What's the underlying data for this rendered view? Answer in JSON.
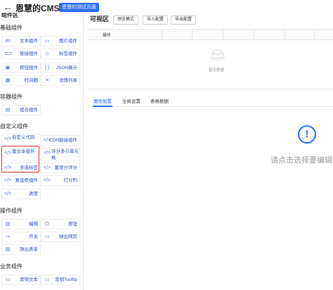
{
  "header": {
    "back_icon": "arrow-left-icon",
    "title": "恩慧的CMS",
    "badge": "恩慧的测试页面"
  },
  "sidebar": {
    "title": "组件区",
    "groups": [
      {
        "title": "基础组件"
      },
      {
        "title": "容器组件"
      },
      {
        "title": "自定义组件"
      },
      {
        "title": "操作组件"
      },
      {
        "title": "业务组件"
      }
    ],
    "items": [
      {
        "label": "文本组件",
        "icon": "text-icon",
        "glyph": "Aᵃ"
      },
      {
        "label": "图片组件",
        "icon": "image-icon",
        "glyph": "▭"
      },
      {
        "label": "链接组件",
        "icon": "link-icon",
        "glyph": "⊂⊃"
      },
      {
        "label": "标签组件",
        "icon": "tag-icon",
        "glyph": "◇"
      },
      {
        "label": "按钮组件",
        "icon": "button-icon",
        "glyph": "▣"
      },
      {
        "label": "JSON展示",
        "icon": "braces-icon",
        "glyph": "{ }"
      },
      {
        "label": "时间戳",
        "icon": "calendar-icon",
        "glyph": "▦"
      },
      {
        "label": "详情列表",
        "icon": "list-icon",
        "glyph": "≡"
      },
      {
        "label": "组合组件",
        "icon": "combine-icon",
        "glyph": "▤"
      },
      {
        "label": "自定义代码",
        "icon": "code-icon",
        "glyph": "</>"
      },
      {
        "label": "CDN链接组件",
        "icon": "code-icon",
        "glyph": "</>"
      },
      {
        "label": "富文本组件",
        "icon": "code-icon",
        "glyph": "</>"
      },
      {
        "label": "评分多行单元格",
        "icon": "code-icon",
        "glyph": "</>"
      },
      {
        "label": "多选标签",
        "icon": "code-icon",
        "glyph": "</>"
      },
      {
        "label": "客观分评分",
        "icon": "code-icon",
        "glyph": "</>"
      },
      {
        "label": "复选框组件",
        "icon": "code-icon",
        "glyph": "</>"
      },
      {
        "label": "打分列",
        "icon": "code-icon",
        "glyph": "</>"
      },
      {
        "label": "进度",
        "icon": "code-icon",
        "glyph": "</>"
      },
      {
        "label": "编辑",
        "icon": "edit-icon",
        "glyph": "▧"
      },
      {
        "label": "按钮",
        "icon": "power-icon",
        "glyph": "⏻"
      },
      {
        "label": "开关",
        "icon": "switch-icon",
        "glyph": "⊸"
      },
      {
        "label": "弹出网页",
        "icon": "window-icon",
        "glyph": "▭"
      },
      {
        "label": "弹出表单",
        "icon": "form-icon",
        "glyph": "▤"
      },
      {
        "label": "营销文本",
        "icon": "file-icon",
        "glyph": "▭"
      },
      {
        "label": "营销Tooltip",
        "icon": "file-icon",
        "glyph": "▭"
      }
    ]
  },
  "canvas": {
    "title": "可视区",
    "buttons": [
      "预览模式",
      "导入配置",
      "导出配置"
    ],
    "table": {
      "operation_header": "操作"
    },
    "empty_icon": "empty-box-icon",
    "empty_text": "暂无数据"
  },
  "config": {
    "tabs": [
      "属性配置",
      "全局设置",
      "表格数据"
    ],
    "active_tab": 0,
    "info_icon": "info-circle-icon",
    "hint": "请点击选择要编辑的"
  },
  "colors": {
    "accent": "#2b6cf5",
    "highlight_border": "#e0302a"
  }
}
